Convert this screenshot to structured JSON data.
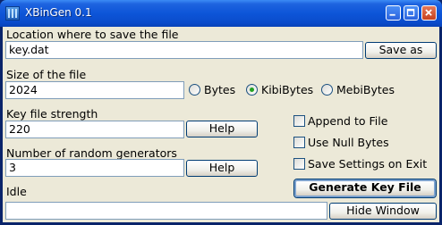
{
  "window": {
    "title": "XBinGen 0.1"
  },
  "location": {
    "label": "Location where to save the file",
    "value": "key.dat",
    "save_as": "Save as"
  },
  "size": {
    "label": "Size of the file",
    "value": "2024",
    "units": [
      {
        "label": "Bytes",
        "checked": false
      },
      {
        "label": "KibiBytes",
        "checked": true
      },
      {
        "label": "MebiBytes",
        "checked": false
      }
    ]
  },
  "strength": {
    "label": "Key file strength",
    "value": "220",
    "help": "Help"
  },
  "generators": {
    "label": "Number of random generators",
    "value": "3",
    "help": "Help"
  },
  "options": [
    {
      "label": "Append to File",
      "checked": false
    },
    {
      "label": "Use Null Bytes",
      "checked": false
    },
    {
      "label": "Save Settings on Exit",
      "checked": false
    }
  ],
  "generate_label": "Generate Key File",
  "status": {
    "label": "Idle",
    "value": ""
  },
  "hide_window": "Hide Window",
  "colors": {
    "titlebar": "#0d55d8",
    "client": "#ece9d8",
    "input_border": "#7f9db9",
    "radio_dot": "#21a121"
  }
}
